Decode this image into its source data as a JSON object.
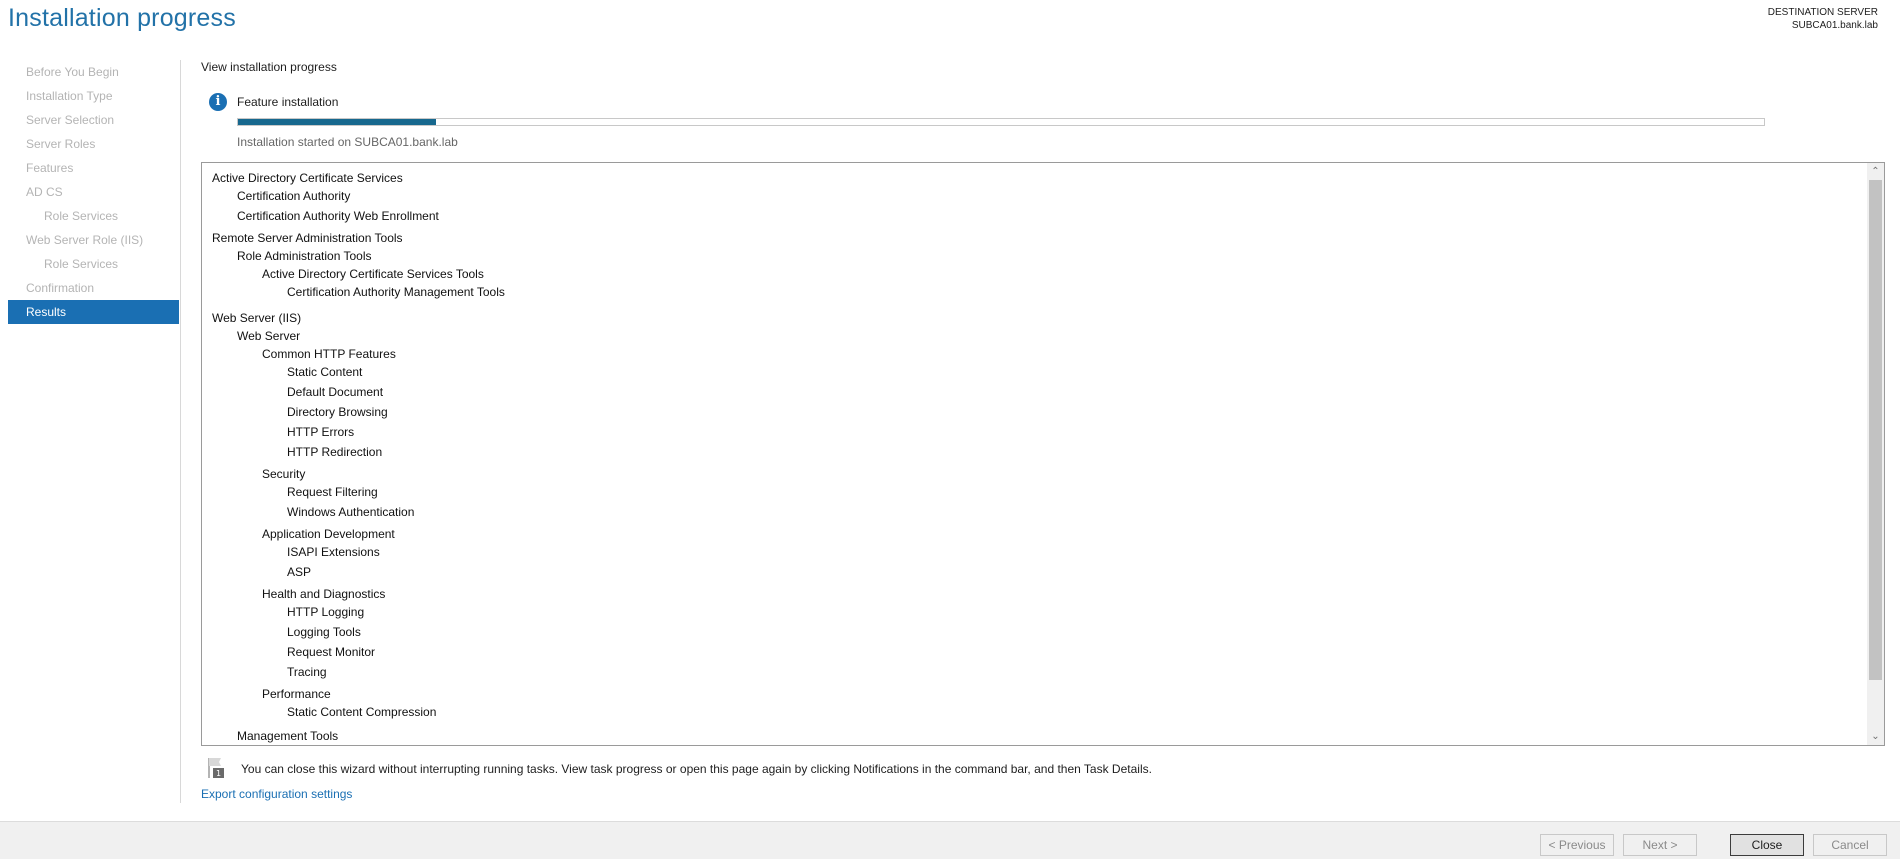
{
  "header": {
    "title": "Installation progress",
    "destination_label": "DESTINATION SERVER",
    "destination_server": "SUBCA01.bank.lab"
  },
  "nav": [
    {
      "label": "Before You Begin",
      "level": 0,
      "active": false
    },
    {
      "label": "Installation Type",
      "level": 0,
      "active": false
    },
    {
      "label": "Server Selection",
      "level": 0,
      "active": false
    },
    {
      "label": "Server Roles",
      "level": 0,
      "active": false
    },
    {
      "label": "Features",
      "level": 0,
      "active": false
    },
    {
      "label": "AD CS",
      "level": 0,
      "active": false
    },
    {
      "label": "Role Services",
      "level": 1,
      "active": false
    },
    {
      "label": "Web Server Role (IIS)",
      "level": 0,
      "active": false
    },
    {
      "label": "Role Services",
      "level": 1,
      "active": false
    },
    {
      "label": "Confirmation",
      "level": 0,
      "active": false
    },
    {
      "label": "Results",
      "level": 0,
      "active": true
    }
  ],
  "main": {
    "section_title": "View installation progress",
    "feature_label": "Feature installation",
    "progress_fraction": 0.13,
    "started_text": "Installation started on SUBCA01.bank.lab",
    "note_text": "You can close this wizard without interrupting running tasks. View task progress or open this page again by clicking Notifications in the command bar, and then Task Details.",
    "note_badge": "1",
    "export_link": "Export configuration settings"
  },
  "tree": [
    {
      "label": "Active Directory Certificate Services",
      "level": 0
    },
    {
      "label": "Certification Authority",
      "level": 1
    },
    {
      "label": "Certification Authority Web Enrollment",
      "level": 1
    },
    {
      "label": "Remote Server Administration Tools",
      "level": 0
    },
    {
      "label": "Role Administration Tools",
      "level": 1
    },
    {
      "label": "Active Directory Certificate Services Tools",
      "level": 2
    },
    {
      "label": "Certification Authority Management Tools",
      "level": 3
    },
    {
      "label": "Web Server (IIS)",
      "level": 0
    },
    {
      "label": "Web Server",
      "level": 1
    },
    {
      "label": "Common HTTP Features",
      "level": 2
    },
    {
      "label": "Static Content",
      "level": 3
    },
    {
      "label": "Default Document",
      "level": 3
    },
    {
      "label": "Directory Browsing",
      "level": 3
    },
    {
      "label": "HTTP Errors",
      "level": 3
    },
    {
      "label": "HTTP Redirection",
      "level": 3
    },
    {
      "label": "Security",
      "level": 2
    },
    {
      "label": "Request Filtering",
      "level": 3
    },
    {
      "label": "Windows Authentication",
      "level": 3
    },
    {
      "label": "Application Development",
      "level": 2
    },
    {
      "label": "ISAPI Extensions",
      "level": 3
    },
    {
      "label": "ASP",
      "level": 3
    },
    {
      "label": "Health and Diagnostics",
      "level": 2
    },
    {
      "label": "HTTP Logging",
      "level": 3
    },
    {
      "label": "Logging Tools",
      "level": 3
    },
    {
      "label": "Request Monitor",
      "level": 3
    },
    {
      "label": "Tracing",
      "level": 3
    },
    {
      "label": "Performance",
      "level": 2
    },
    {
      "label": "Static Content Compression",
      "level": 3
    },
    {
      "label": "Management Tools",
      "level": 1
    }
  ],
  "footer": {
    "previous": "< Previous",
    "next": "Next >",
    "close": "Close",
    "cancel": "Cancel"
  }
}
